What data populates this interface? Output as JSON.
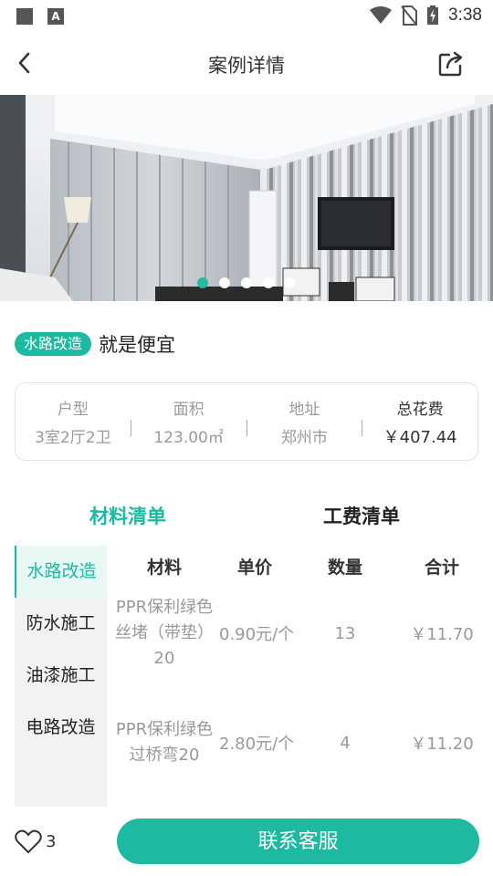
{
  "status_bar": {
    "time": "3:38",
    "notif_a": "A"
  },
  "header": {
    "title": "案例详情"
  },
  "gallery": {
    "dot_count": 5,
    "active_index": 0
  },
  "case": {
    "tag": "水路改造",
    "title": "就是便宜"
  },
  "info": {
    "layout": {
      "label": "户型",
      "value": "3室2厅2卫"
    },
    "area": {
      "label": "面积",
      "value": "123.00㎡"
    },
    "address": {
      "label": "地址",
      "value": "郑州市"
    },
    "total": {
      "label": "总花费",
      "value": "￥407.44"
    }
  },
  "tabs": {
    "materials": "材料清单",
    "labor": "工费清单",
    "active": "materials"
  },
  "categories": [
    "水路改造",
    "防水施工",
    "油漆施工",
    "电路改造"
  ],
  "table": {
    "headers": [
      "材料",
      "单价",
      "数量",
      "合计"
    ],
    "rows": [
      {
        "material": "PPR保利绿色丝堵（带垫）20",
        "price": "0.90元/个",
        "qty": "13",
        "total": "￥11.70"
      },
      {
        "material": "PPR保利绿色过桥弯20",
        "price": "2.80元/个",
        "qty": "4",
        "total": "￥11.20"
      }
    ]
  },
  "bottom": {
    "likes": "3",
    "contact_label": "联系客服"
  },
  "colors": {
    "accent": "#1db9a0"
  }
}
